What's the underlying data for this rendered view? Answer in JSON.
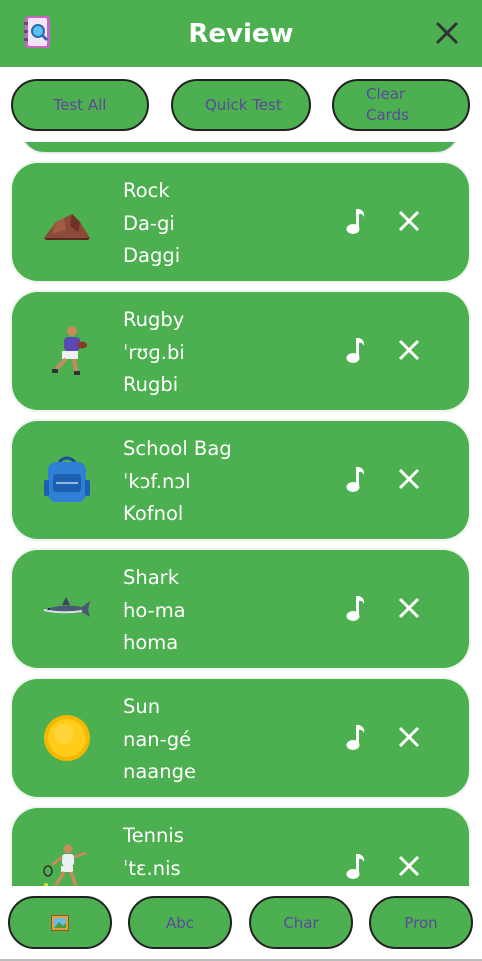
{
  "header": {
    "title": "Review",
    "app_icon": "notebook-search-icon",
    "close_icon": "close-icon"
  },
  "top_buttons": [
    {
      "label": "Test All"
    },
    {
      "label": "Quick Test"
    },
    {
      "label": "Clear Cards"
    }
  ],
  "cards": [
    {
      "word": "Rock",
      "pronunciation": "Da-gi",
      "translation": "Daggi",
      "image": "rock-icon"
    },
    {
      "word": "Rugby",
      "pronunciation": "ˈrʊɡ.bi",
      "translation": "Rugbi",
      "image": "rugby-player-icon"
    },
    {
      "word": "School Bag",
      "pronunciation": "ˈkɔf.nɔl",
      "translation": "Kofnol",
      "image": "school-bag-icon"
    },
    {
      "word": "Shark",
      "pronunciation": "ho-ma",
      "translation": "homa",
      "image": "shark-icon"
    },
    {
      "word": "Sun",
      "pronunciation": "nan-gé",
      "translation": "naange",
      "image": "sun-icon"
    },
    {
      "word": "Tennis",
      "pronunciation": "ˈtɛ.nis",
      "translation": "",
      "image": "tennis-player-icon"
    }
  ],
  "bottom_buttons": [
    {
      "label": "",
      "icon": "picture-icon"
    },
    {
      "label": "Abc"
    },
    {
      "label": "Char"
    },
    {
      "label": "Pron"
    }
  ],
  "colors": {
    "accent": "#4CAF50",
    "button_text": "#5b4a9a",
    "border": "#222222"
  }
}
